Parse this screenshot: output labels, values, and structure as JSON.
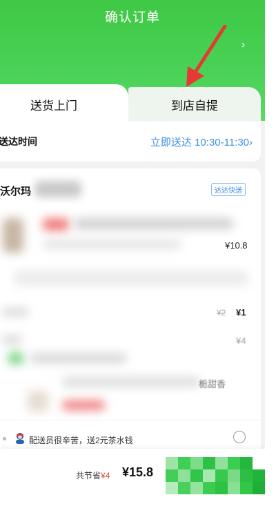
{
  "header": {
    "title": "确认订单",
    "chevron": "›"
  },
  "annotation": {
    "arrow_color": "#e53935"
  },
  "tabs": [
    {
      "label": "送货上门",
      "active": true
    },
    {
      "label": "到店自提",
      "active": false
    }
  ],
  "delivery": {
    "label": "送达时间",
    "value": "立即送达 10:30-11:30",
    "chevron": "›"
  },
  "store": {
    "name": "沃尔玛",
    "badge": "达达快送"
  },
  "items": {
    "price_1": "¥10.8",
    "old_price": "¥2",
    "price_2": "¥1",
    "price_3": "¥4",
    "fragment": "栀甜香"
  },
  "tip": {
    "text": "配送员很辛苦，送2元茶水钱",
    "icon": "courier-icon"
  },
  "footer": {
    "saved_label": "共节省",
    "saved_amount": "¥4",
    "total": "¥15.8"
  },
  "colors": {
    "brand_green": "#44cc4f",
    "link_blue": "#3a8ee6",
    "discount_red": "#e34a3a"
  }
}
